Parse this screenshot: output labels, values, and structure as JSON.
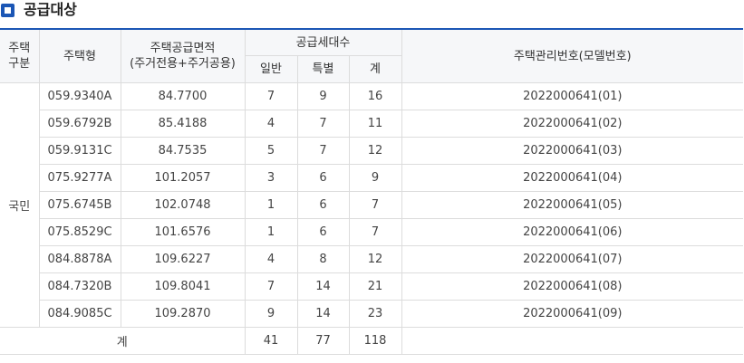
{
  "section": {
    "title": "공급대상"
  },
  "table": {
    "headers": {
      "housing_type_line1": "주택",
      "housing_type_line2": "구분",
      "model": "주택형",
      "area_line1": "주택공급면적",
      "area_line2": "(주거전용+주거공용)",
      "supply_units": "공급세대수",
      "general": "일반",
      "special": "특별",
      "sum": "계",
      "management_no": "주택관리번호(모델번호)"
    },
    "category": "국민",
    "rows": [
      {
        "model": "059.9340A",
        "area": "84.7700",
        "general": "7",
        "special": "9",
        "total": "16",
        "code": "2022000641(01)"
      },
      {
        "model": "059.6792B",
        "area": "85.4188",
        "general": "4",
        "special": "7",
        "total": "11",
        "code": "2022000641(02)"
      },
      {
        "model": "059.9131C",
        "area": "84.7535",
        "general": "5",
        "special": "7",
        "total": "12",
        "code": "2022000641(03)"
      },
      {
        "model": "075.9277A",
        "area": "101.2057",
        "general": "3",
        "special": "6",
        "total": "9",
        "code": "2022000641(04)"
      },
      {
        "model": "075.6745B",
        "area": "102.0748",
        "general": "1",
        "special": "6",
        "total": "7",
        "code": "2022000641(05)"
      },
      {
        "model": "075.8529C",
        "area": "101.6576",
        "general": "1",
        "special": "6",
        "total": "7",
        "code": "2022000641(06)"
      },
      {
        "model": "084.8878A",
        "area": "109.6227",
        "general": "4",
        "special": "8",
        "total": "12",
        "code": "2022000641(07)"
      },
      {
        "model": "084.7320B",
        "area": "109.8041",
        "general": "7",
        "special": "14",
        "total": "21",
        "code": "2022000641(08)"
      },
      {
        "model": "084.9085C",
        "area": "109.2870",
        "general": "9",
        "special": "14",
        "total": "23",
        "code": "2022000641(09)"
      }
    ],
    "total": {
      "label": "계",
      "general": "41",
      "special": "77",
      "total": "118",
      "code": ""
    }
  }
}
